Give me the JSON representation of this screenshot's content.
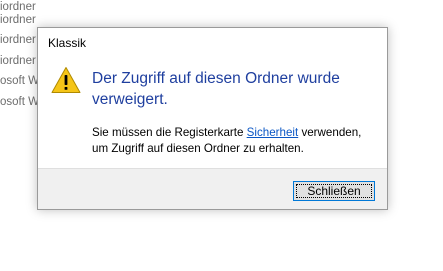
{
  "background": {
    "rows": [
      "iordner",
      "iordner",
      "iordner",
      "iordner",
      "osoft W",
      "osoft W"
    ]
  },
  "dialog": {
    "title": "Klassik",
    "icon": "warning-icon",
    "main_instruction": "Der Zugriff auf diesen Ordner wurde verweigert.",
    "detail_before_link": "Sie müssen die Registerkarte ",
    "detail_link": "Sicherheit",
    "detail_after_link": " verwenden, um Zugriff auf diesen Ordner zu erhalten.",
    "close_button_label": "Schließen"
  },
  "colors": {
    "main_instruction": "#1f3f9f",
    "link": "#0b57c5",
    "footer_bg": "#f0f0f0",
    "button_focus_border": "#0078d7",
    "warning_fill": "#f5c518"
  }
}
